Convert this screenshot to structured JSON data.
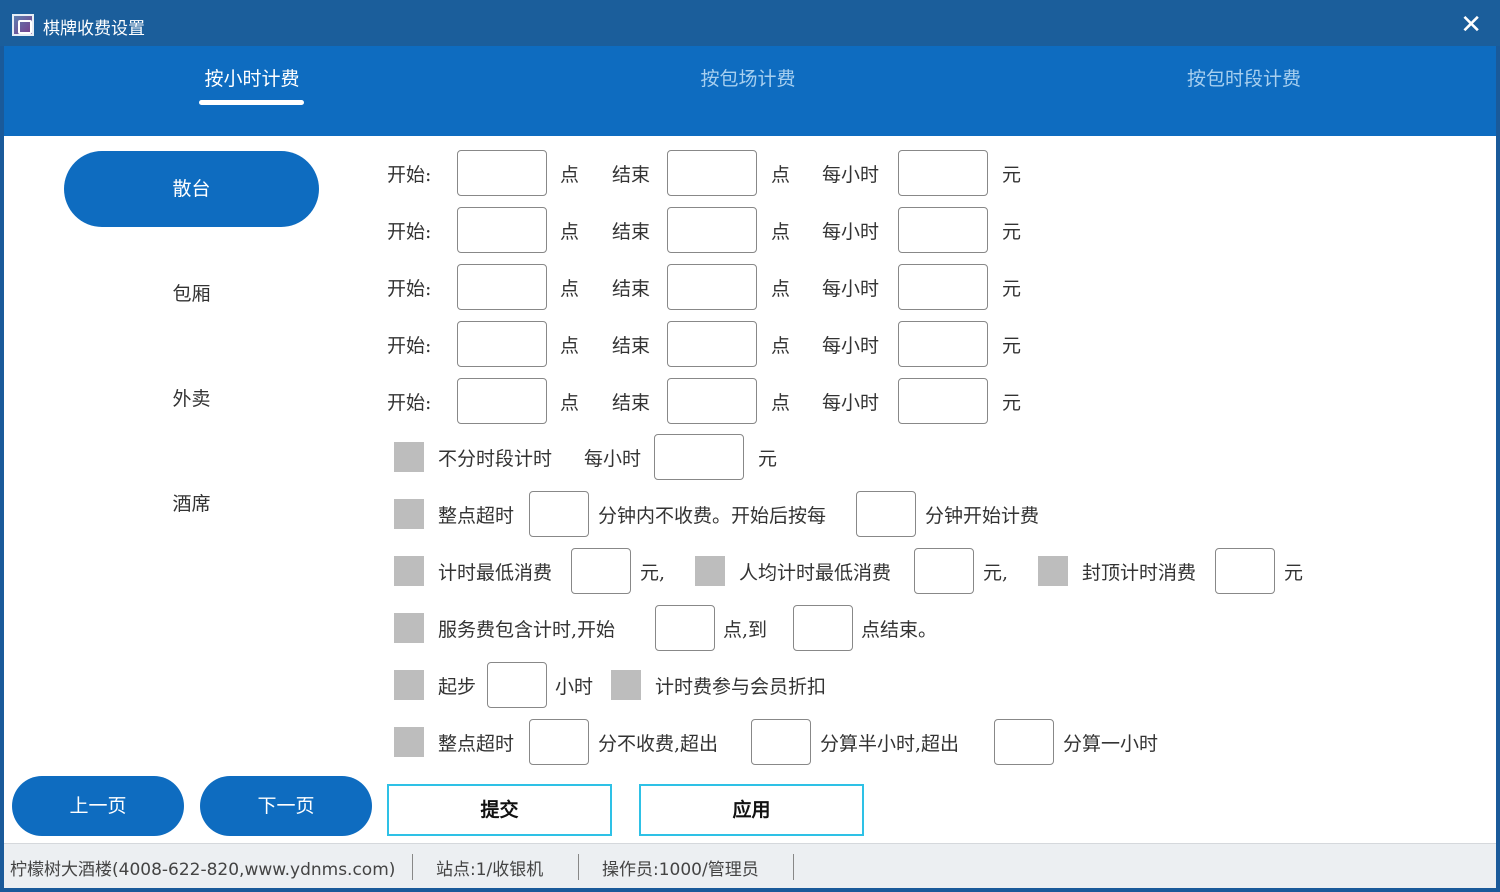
{
  "window": {
    "title": "棋牌收费设置",
    "close_glyph": "✕"
  },
  "tabs": [
    {
      "label": "按小时计费",
      "active": true
    },
    {
      "label": "按包场计费",
      "active": false
    },
    {
      "label": "按包时段计费",
      "active": false
    }
  ],
  "sidebar": {
    "items": [
      {
        "label": "散台",
        "active": true
      },
      {
        "label": "包厢",
        "active": false
      },
      {
        "label": "外卖",
        "active": false
      },
      {
        "label": "酒席",
        "active": false
      }
    ]
  },
  "rows": {
    "start_label": "开始:",
    "hour_unit": "点",
    "end_label": "结束",
    "per_hour_label": "每小时",
    "yuan": "元",
    "count": 5
  },
  "options": {
    "no_period": {
      "label": "不分时段计时",
      "per_hour": "每小时",
      "unit": "元"
    },
    "whole_hour": {
      "label": "整点超时",
      "mid": "分钟内不收费。开始后按每",
      "end": "分钟开始计费"
    },
    "min_charge": {
      "label": "计时最低消费",
      "unit1": "元,",
      "per_person": "人均计时最低消费",
      "unit2": "元,",
      "cap": "封顶计时消费",
      "unit3": "元"
    },
    "service": {
      "label": "服务费包含计时,开始",
      "mid": "点,到",
      "end": "点结束。"
    },
    "start_step": {
      "label": "起步",
      "unit": "小时",
      "member": "计时费参与会员折扣"
    },
    "rounding": {
      "label": "整点超时",
      "mid1": "分不收费,超出",
      "mid2": "分算半小时,超出",
      "end": "分算一小时"
    }
  },
  "buttons": {
    "prev": "上一页",
    "next": "下一页",
    "submit": "提交",
    "apply": "应用"
  },
  "status": {
    "company": "柠檬树大酒楼(4008-622-820,www.ydnms.com)",
    "station": "站点:1/收银机",
    "operator": "操作员:1000/管理员"
  },
  "colors": {
    "primary": "#0e6cc0",
    "titlebar": "#1b5e9b",
    "accent_border": "#2ec1e6",
    "checkbox": "#bdbdbd"
  }
}
